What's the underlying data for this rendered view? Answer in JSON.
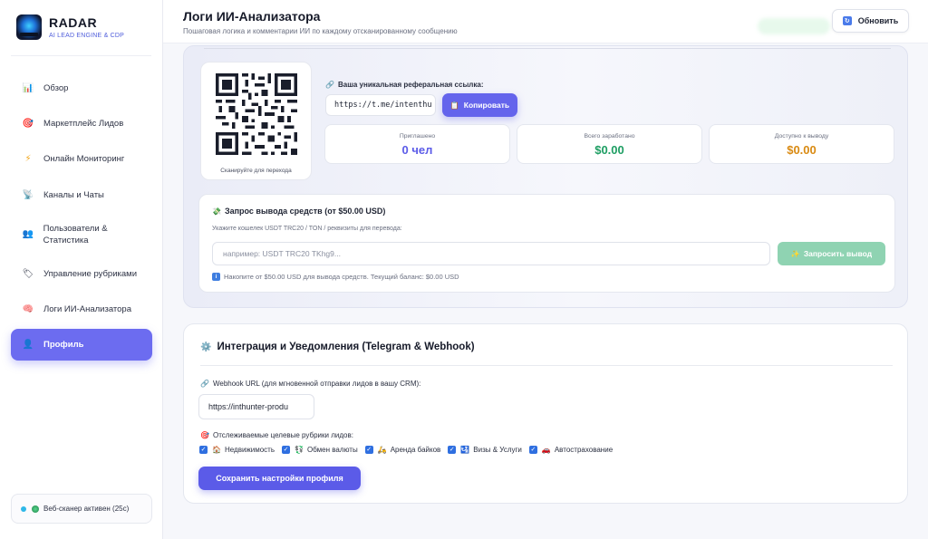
{
  "brand": {
    "name": "RADAR",
    "subtitle": "AI LEAD ENGINE & CDP"
  },
  "sidebar": {
    "items": [
      {
        "label": "Обзор",
        "icon": "bar-chart-icon"
      },
      {
        "label": "Маркетплейс Лидов",
        "icon": "target-icon"
      },
      {
        "label": "Онлайн Мониторинг",
        "icon": "lightning-icon"
      },
      {
        "label": "Каналы и Чаты",
        "icon": "satellite-icon"
      },
      {
        "label": "Пользователи & Статистика",
        "icon": "users-icon"
      },
      {
        "label": "Управление рубриками",
        "icon": "tag-icon"
      },
      {
        "label": "Логи ИИ-Анализатора",
        "icon": "brain-icon"
      },
      {
        "label": "Профиль",
        "icon": "user-icon",
        "active": true
      }
    ],
    "scanner_status": "Веб-сканер активен (25с)"
  },
  "header": {
    "title": "Логи ИИ-Анализатора",
    "subtitle": "Пошаговая логика и комментарии ИИ по каждому отсканированному сообщению",
    "refresh_label": "Обновить"
  },
  "referral": {
    "qr_caption": "Сканируйте для перехода",
    "link_label": "Ваша уникальная реферальная ссылка:",
    "link_value": "https://t.me/intenthu",
    "copy_label": "Копировать",
    "stats": [
      {
        "key": "Приглашено",
        "value": "0 чел",
        "color": "#5b5be8"
      },
      {
        "key": "Всего заработано",
        "value": "$0.00",
        "color": "#1e9e63"
      },
      {
        "key": "Доступно к выводу",
        "value": "$0.00",
        "color": "#d98a12"
      }
    ]
  },
  "withdraw": {
    "title": "Запрос вывода средств (от $50.00 USD)",
    "hint": "Укажите кошелек USDT TRC20 / TON / реквизиты для перевода:",
    "placeholder": "например: USDT TRC20 TKhg9...",
    "button_label": "Запросить вывод",
    "note": "Накопите от $50.00 USD для вывода средств. Текущий баланс: $0.00 USD"
  },
  "integration": {
    "title": "Интеграция и Уведомления (Telegram & Webhook)",
    "webhook_label": "Webhook URL (для мгновенной отправки лидов в вашу CRM):",
    "webhook_value": "https://inthunter-produ",
    "categories_label": "Отслеживаемые целевые рубрики лидов:",
    "categories": [
      {
        "label": "Недвижимость",
        "emoji": "🏠",
        "checked": true
      },
      {
        "label": "Обмен валюты",
        "emoji": "💱",
        "checked": true
      },
      {
        "label": "Аренда байков",
        "emoji": "🛵",
        "checked": true
      },
      {
        "label": "Визы & Услуги",
        "emoji": "🛂",
        "checked": true
      },
      {
        "label": "Автострахование",
        "emoji": "🚗",
        "checked": true
      }
    ],
    "save_label": "Сохранить настройки профиля"
  }
}
